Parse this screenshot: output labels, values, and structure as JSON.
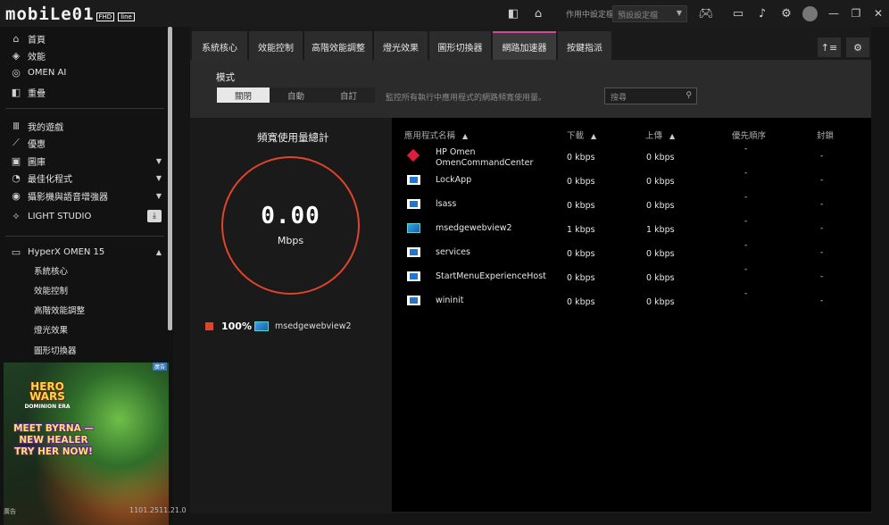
{
  "titlebar": {
    "logo": "mobiLe01",
    "logo_badge": "FHD",
    "logo_tag": "line",
    "profile_label": "作用中設定檔",
    "profile_value": "預設設定檔"
  },
  "sidebar": {
    "items": [
      {
        "label": "首頁",
        "icon": "home-icon"
      },
      {
        "label": "效能",
        "icon": "performance-icon"
      },
      {
        "label": "OMEN AI",
        "icon": "ai-icon"
      },
      {
        "label": "重疊",
        "icon": "overlay-icon"
      },
      {
        "label": "我的遊戲",
        "icon": "library-icon"
      },
      {
        "label": "優惠",
        "icon": "offers-icon"
      },
      {
        "label": "圖庫",
        "icon": "gallery-icon"
      },
      {
        "label": "最佳化程式",
        "icon": "optimizer-icon"
      },
      {
        "label": "攝影機與語音增強器",
        "icon": "camera-icon"
      },
      {
        "label": "LIGHT STUDIO",
        "icon": "sparkle-icon"
      },
      {
        "label": "HyperX OMEN 15",
        "icon": "laptop-icon"
      }
    ],
    "sub_items": [
      "系統核心",
      "效能控制",
      "高階效能調整",
      "燈光效果",
      "圖形切換器"
    ],
    "ad": {
      "logo": "HERO WARS",
      "logo_sub": "DOMINION ERA",
      "headline": "MEET BYRNA — NEW HEALER TRY HER NOW!",
      "badge": "廣告"
    },
    "footer_label": "廣告",
    "version": "1101.2511.21.0"
  },
  "tabs": [
    "系統核心",
    "效能控制",
    "高階效能調整",
    "燈光效果",
    "圖形切換器",
    "網路加速器",
    "按鍵指派"
  ],
  "mode": {
    "label": "模式",
    "options": [
      "關閉",
      "自動",
      "自訂"
    ],
    "selected": "關閉",
    "description": "監控所有執行中應用程式的網路頻寬使用量。",
    "search_placeholder": "搜尋"
  },
  "bandwidth": {
    "title": "頻寬使用量總計",
    "value": "0.00",
    "unit": "Mbps",
    "legend_pct": "100%",
    "legend_app": "msedgewebview2",
    "accent": "#e0442a"
  },
  "table": {
    "headers": {
      "app": "應用程式名稱",
      "download": "下載",
      "upload": "上傳",
      "priority": "優先順序",
      "block": "封鎖"
    },
    "rows": [
      {
        "name1": "HP Omen",
        "name2": "OmenCommandCenter",
        "icon": "omen",
        "down": "0 kbps",
        "up": "0 kbps",
        "priority": "-",
        "block": "-"
      },
      {
        "name1": "LockApp",
        "name2": "",
        "icon": "win",
        "down": "0 kbps",
        "up": "0 kbps",
        "priority": "-",
        "block": "-"
      },
      {
        "name1": "lsass",
        "name2": "",
        "icon": "win",
        "down": "0 kbps",
        "up": "0 kbps",
        "priority": "-",
        "block": "-"
      },
      {
        "name1": "msedgewebview2",
        "name2": "",
        "icon": "edge",
        "down": "1 kbps",
        "up": "1 kbps",
        "priority": "-",
        "block": "-"
      },
      {
        "name1": "services",
        "name2": "",
        "icon": "win",
        "down": "0 kbps",
        "up": "0 kbps",
        "priority": "-",
        "block": "-"
      },
      {
        "name1": "StartMenuExperienceHost",
        "name2": "",
        "icon": "win",
        "down": "0 kbps",
        "up": "0 kbps",
        "priority": "-",
        "block": "-"
      },
      {
        "name1": "wininit",
        "name2": "",
        "icon": "win",
        "down": "0 kbps",
        "up": "0 kbps",
        "priority": "-",
        "block": "-"
      }
    ]
  }
}
